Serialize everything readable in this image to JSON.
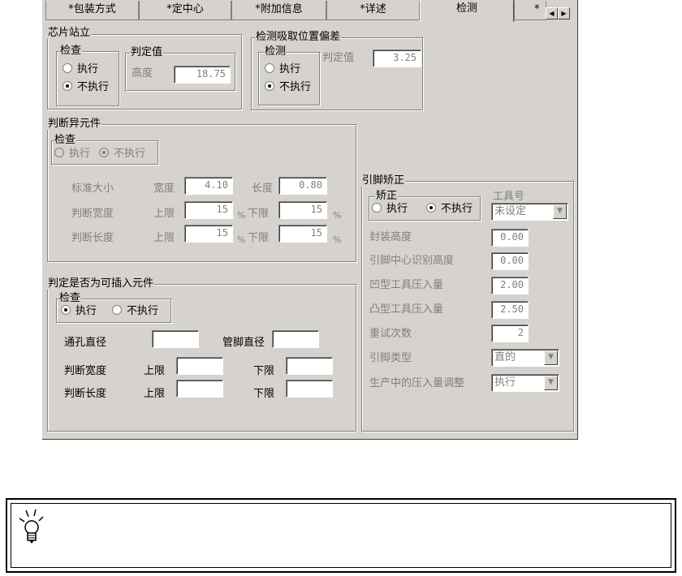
{
  "tabs": [
    {
      "label": "*包装方式"
    },
    {
      "label": "*定中心"
    },
    {
      "label": "*附加信息"
    },
    {
      "label": "*详述"
    },
    {
      "label": "检测"
    },
    {
      "label": "*"
    }
  ],
  "chip_stand": {
    "title": "芯片站立",
    "check_title": "检查",
    "execute": "执行",
    "not_execute": "不执行",
    "judge_title": "判定值",
    "height_label": "高度",
    "height_value": "18.75"
  },
  "pick_offset": {
    "title": "检测吸取位置偏差",
    "detect_title": "检测",
    "execute": "执行",
    "not_execute": "不执行",
    "judge_label": "判定值",
    "judge_value": "3.25"
  },
  "abnormal": {
    "title": "判断异元件",
    "check_title": "检查",
    "execute": "执行",
    "not_execute": "不执行",
    "std_size": "标准大小",
    "width_label": "宽度",
    "width_value": "4.10",
    "length_label": "长度",
    "length_value": "0.80",
    "judge_width": "判断宽度",
    "judge_length": "判断长度",
    "upper": "上限",
    "lower": "下限",
    "pct": "%",
    "width_upper": "15",
    "width_lower": "15",
    "length_upper": "15",
    "length_lower": "15"
  },
  "insert": {
    "title": "判定是否为可插入元件",
    "check_title": "检查",
    "execute": "执行",
    "not_execute": "不执行",
    "hole_dia": "通孔直径",
    "pin_dia": "管脚直径",
    "judge_width": "判断宽度",
    "judge_length": "判断长度",
    "upper": "上限",
    "lower": "下限"
  },
  "lead": {
    "title": "引脚矫正",
    "correct_title": "矫正",
    "execute": "执行",
    "not_execute": "不执行",
    "tool_no": "工具号",
    "tool_value": "未设定",
    "pkg_height": "封装高度",
    "pkg_height_value": "0.00",
    "center_height": "引脚中心识别高度",
    "center_height_value": "0.00",
    "concave_press": "凹型工具压入量",
    "concave_value": "2.00",
    "convex_press": "凸型工具压入量",
    "convex_value": "2.50",
    "retry": "重试次数",
    "retry_value": "2",
    "lead_type": "引脚类型",
    "lead_type_value": "直的",
    "press_adjust": "生产中的压入量调整",
    "press_adjust_value": "执行"
  }
}
